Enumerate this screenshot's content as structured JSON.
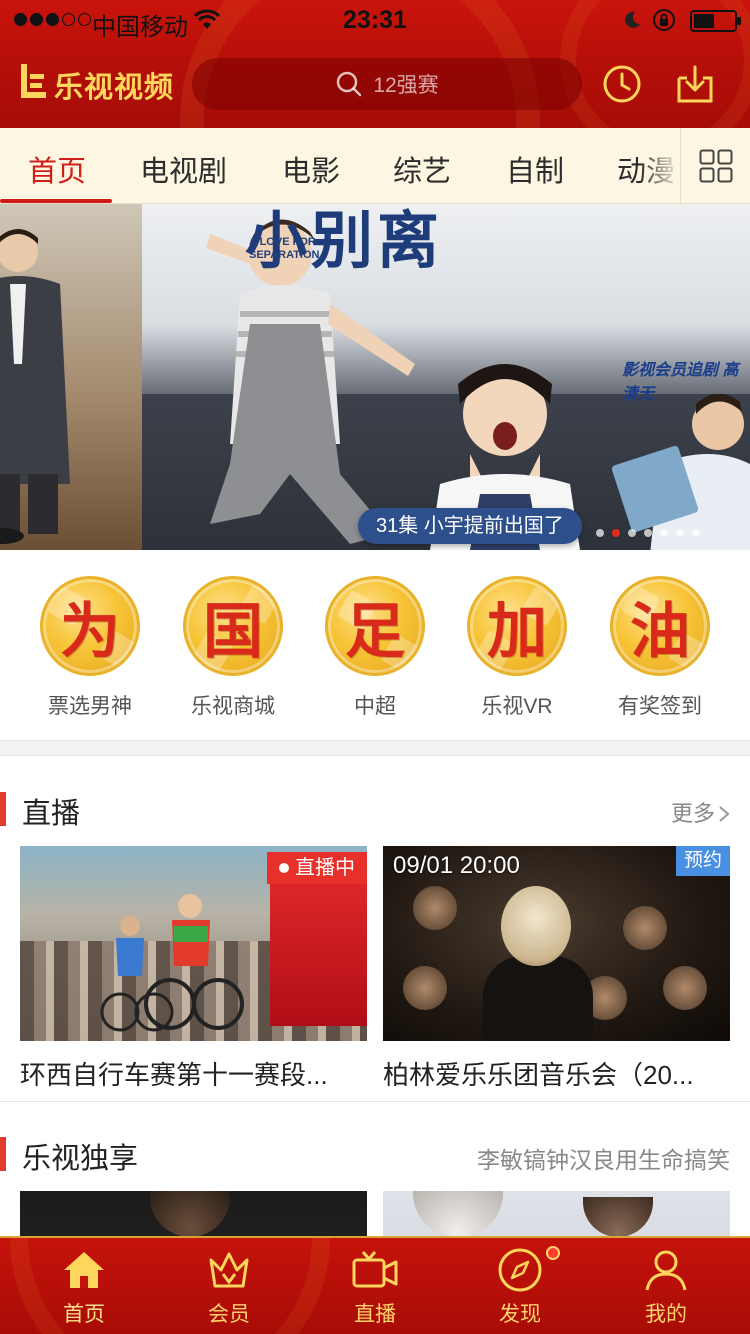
{
  "status_bar": {
    "carrier": "中国移动",
    "time": "23:31"
  },
  "app_bar": {
    "logo_text": "乐视视频",
    "search_placeholder": "12强赛"
  },
  "channel_tabs": [
    {
      "label": "首页",
      "active": true
    },
    {
      "label": "电视剧",
      "active": false
    },
    {
      "label": "电影",
      "active": false
    },
    {
      "label": "综艺",
      "active": false
    },
    {
      "label": "自制",
      "active": false
    },
    {
      "label": "动漫",
      "active": false
    }
  ],
  "banner": {
    "title_art": "小别离",
    "english_title": "A LOVE FOR SEPARATION",
    "caption": "31集  小宇提前出国了",
    "tag": "影视会员追剧 高清无",
    "page_count": 7,
    "active_page": 2
  },
  "shortcuts": [
    {
      "char": "为",
      "label": "票选男神"
    },
    {
      "char": "国",
      "label": "乐视商城"
    },
    {
      "char": "足",
      "label": "中超"
    },
    {
      "char": "加",
      "label": "乐视VR"
    },
    {
      "char": "油",
      "label": "有奖签到"
    }
  ],
  "live_section": {
    "title": "直播",
    "more": "更多",
    "cards": [
      {
        "title": "环西自行车赛第十一赛段...",
        "badge": "直播中"
      },
      {
        "title": "柏林爱乐乐团音乐会（20...",
        "time": "09/01 20:00",
        "badge": "预约"
      }
    ]
  },
  "exclusive_section": {
    "title": "乐视独享",
    "subtitle": "李敏镐钟汉良用生命搞笑"
  },
  "bottom_tabs": [
    {
      "label": "首页",
      "icon": "home-icon",
      "active": true
    },
    {
      "label": "会员",
      "icon": "crown-icon",
      "active": false
    },
    {
      "label": "直播",
      "icon": "video-camera-icon",
      "active": false
    },
    {
      "label": "发现",
      "icon": "compass-icon",
      "active": false
    },
    {
      "label": "我的",
      "icon": "person-icon",
      "active": false
    }
  ],
  "colors": {
    "brand_red": "#c9140c",
    "accent_gold": "#ffd65c",
    "active_tab": "#d11d17",
    "tab_bg": "#fdf6e2",
    "live_badge": "#e8302b",
    "reserve_badge": "#4a90e2"
  }
}
